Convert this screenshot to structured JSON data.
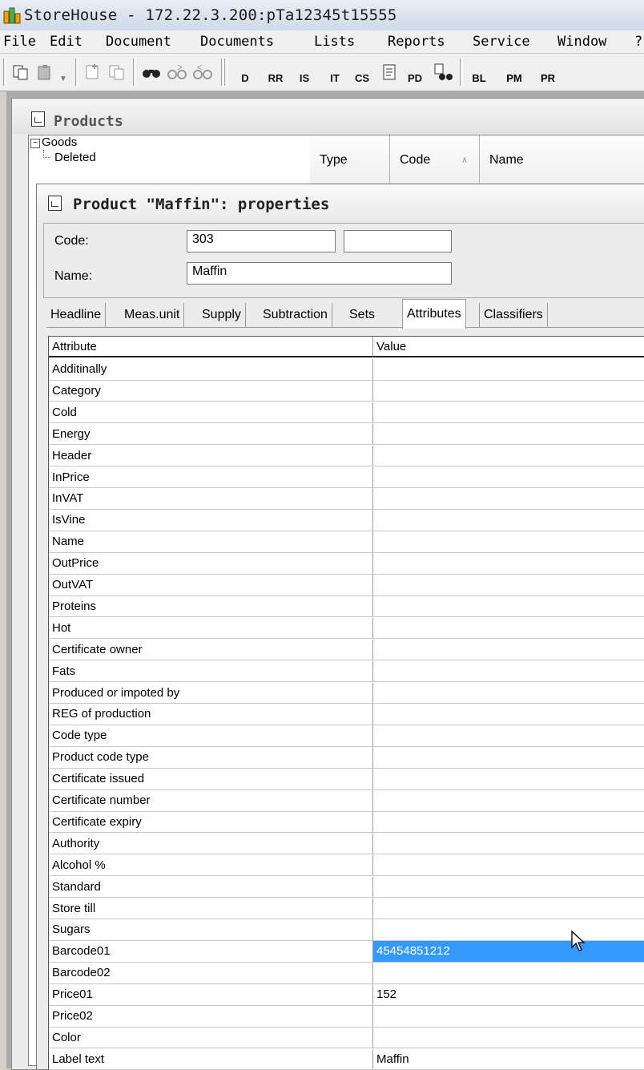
{
  "app": {
    "title": "StoreHouse - 172.22.3.200:pTa12345t15555"
  },
  "menu": [
    "File",
    "Edit",
    "Document",
    "Documents",
    "Lists",
    "Reports",
    "Service",
    "Window",
    "?"
  ],
  "toolbar": {
    "text_buttons": [
      "D",
      "RR",
      "IS",
      "IT",
      "CS",
      "PD",
      "BL",
      "PM",
      "PR"
    ]
  },
  "products_window": {
    "title": "Products",
    "tree": {
      "root": "Goods",
      "toggle": "−",
      "children": [
        "Deleted"
      ]
    },
    "grid_columns": [
      "Type",
      "Code",
      "Name"
    ],
    "code_sort_indicator": "∧"
  },
  "properties_dialog": {
    "title": "Product \"Maffin\": properties",
    "code_label": "Code:",
    "code_value": "303",
    "code_extra_value": "",
    "name_label": "Name:",
    "name_value": "Maffin",
    "tabs": [
      "Headline",
      "Meas.unit",
      "Supply",
      "Subtraction",
      "Sets",
      "Attributes",
      "Classifiers"
    ],
    "active_tab": "Attributes",
    "attributes_table": {
      "columns": [
        "Attribute",
        "Value"
      ],
      "rows": [
        {
          "attribute": "Additinally",
          "value": ""
        },
        {
          "attribute": "Category",
          "value": ""
        },
        {
          "attribute": "Cold",
          "value": ""
        },
        {
          "attribute": "Energy",
          "value": ""
        },
        {
          "attribute": "Header",
          "value": ""
        },
        {
          "attribute": "InPrice",
          "value": ""
        },
        {
          "attribute": "InVAT",
          "value": ""
        },
        {
          "attribute": "IsVine",
          "value": ""
        },
        {
          "attribute": "Name",
          "value": ""
        },
        {
          "attribute": "OutPrice",
          "value": ""
        },
        {
          "attribute": "OutVAT",
          "value": ""
        },
        {
          "attribute": "Proteins",
          "value": ""
        },
        {
          "attribute": "Hot",
          "value": ""
        },
        {
          "attribute": "Certificate owner",
          "value": ""
        },
        {
          "attribute": "Fats",
          "value": ""
        },
        {
          "attribute": "Produced or impoted by",
          "value": ""
        },
        {
          "attribute": "REG of production",
          "value": ""
        },
        {
          "attribute": "Code type",
          "value": ""
        },
        {
          "attribute": "Product code type",
          "value": ""
        },
        {
          "attribute": "Certificate issued",
          "value": ""
        },
        {
          "attribute": "Certificate number",
          "value": ""
        },
        {
          "attribute": "Certificate expiry",
          "value": ""
        },
        {
          "attribute": "Authority",
          "value": ""
        },
        {
          "attribute": "Alcohol %",
          "value": ""
        },
        {
          "attribute": "Standard",
          "value": ""
        },
        {
          "attribute": "Store till",
          "value": ""
        },
        {
          "attribute": "Sugars",
          "value": ""
        },
        {
          "attribute": "Barcode01",
          "value": "4545485121​2",
          "selected": true
        },
        {
          "attribute": "Barcode02",
          "value": ""
        },
        {
          "attribute": "Price01",
          "value": "152"
        },
        {
          "attribute": "Price02",
          "value": ""
        },
        {
          "attribute": "Color",
          "value": ""
        },
        {
          "attribute": "Label text",
          "value": "Maffin"
        }
      ]
    }
  },
  "colors": {
    "selection": "#3399ff",
    "mdi_background": "#ababab"
  }
}
